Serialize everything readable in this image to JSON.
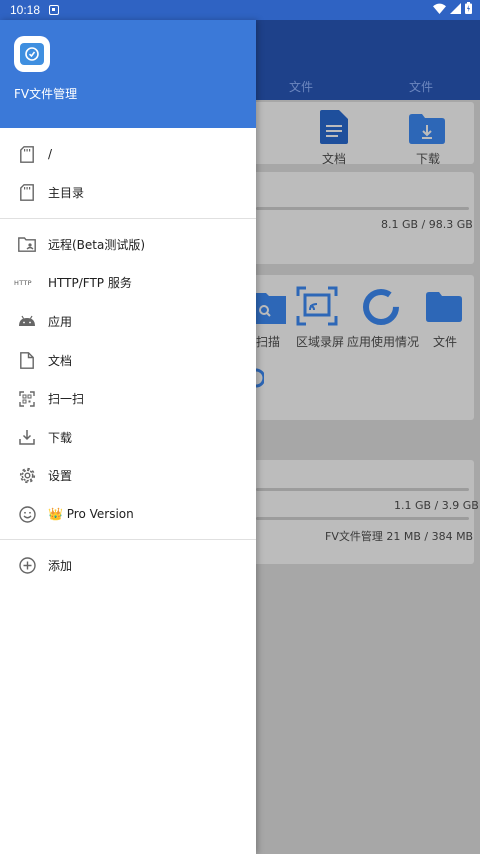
{
  "status_bar": {
    "time": "10:18"
  },
  "drawer": {
    "app_name": "FV文件管理",
    "storage_items": [
      {
        "label": "/",
        "icon": "sd-card-icon"
      },
      {
        "label": "主目录",
        "icon": "sd-card-icon"
      }
    ],
    "nav_items": [
      {
        "label": "远程(Beta测试版)",
        "icon": "remote-folder-icon"
      },
      {
        "label": "HTTP/FTP 服务",
        "icon": "http-icon",
        "icon_text": "HTTP"
      },
      {
        "label": "应用",
        "icon": "android-icon"
      },
      {
        "label": "文档",
        "icon": "document-icon"
      },
      {
        "label": "扫一扫",
        "icon": "qr-scan-icon"
      },
      {
        "label": "下载",
        "icon": "download-icon"
      },
      {
        "label": "设置",
        "icon": "gear-icon"
      },
      {
        "label": "👑 Pro Version",
        "icon": "smiley-icon"
      }
    ],
    "add_item": {
      "label": "添加",
      "icon": "add-circle-icon"
    }
  },
  "background": {
    "tabs": [
      "文件",
      "文件"
    ],
    "quick_access": [
      "文档",
      "下载"
    ],
    "storage_1": {
      "usage": "8.1 GB  /  98.3 GB"
    },
    "tools": [
      "扫描",
      "区域录屏",
      "应用使用情况",
      "文件"
    ],
    "storage_2": {
      "usage": "1.1 GB  /  3.9 GB"
    },
    "storage_3": {
      "usage": "FV文件管理  21 MB  /  384 MB"
    }
  },
  "colors": {
    "status_bar": "#2f63c3",
    "drawer_header": "#3b79d8",
    "app_bar_dimmed": "#1e418a",
    "scrim": "#a7a7a7"
  }
}
